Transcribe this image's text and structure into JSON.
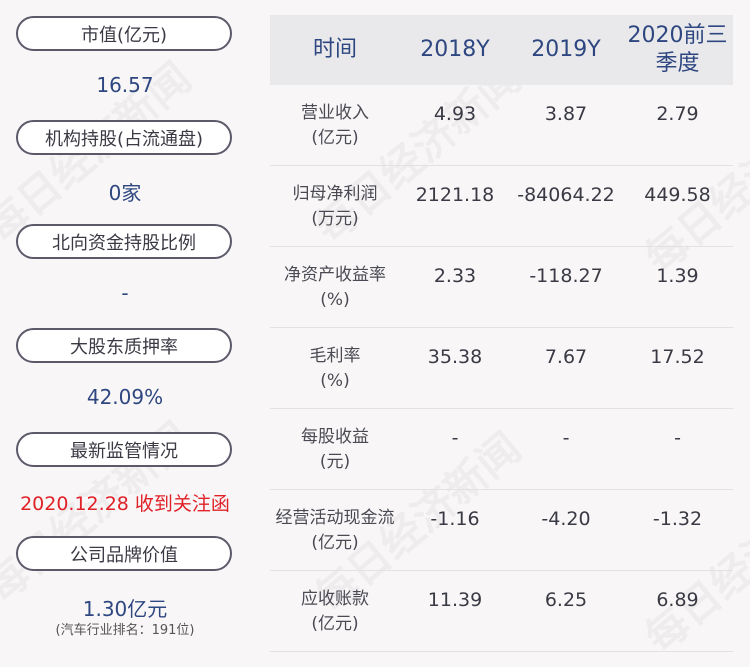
{
  "watermark_text": "每日经济新闻",
  "left": {
    "items": [
      {
        "label": "市值(亿元)",
        "value": "16.57"
      },
      {
        "label": "机构持股(占流通盘)",
        "value": "0家"
      },
      {
        "label": "北向资金持股比例",
        "value": "-"
      },
      {
        "label": "大股东质押率",
        "value": "42.09%"
      },
      {
        "label": "最新监管情况",
        "value": "2020.12.28 收到关注函"
      },
      {
        "label": "公司品牌价值",
        "value": "1.30亿元",
        "sub": "(汽车行业排名：191位)"
      }
    ]
  },
  "table": {
    "headers": [
      "时间",
      "2018Y",
      "2019Y",
      "2020前三季度"
    ],
    "rows": [
      {
        "label1": "营业收入",
        "label2": "(亿元)",
        "v": [
          "4.93",
          "3.87",
          "2.79"
        ]
      },
      {
        "label1": "归母净利润",
        "label2": "(万元)",
        "v": [
          "2121.18",
          "-84064.22",
          "449.58"
        ]
      },
      {
        "label1": "净资产收益率",
        "label2": "(%)",
        "v": [
          "2.33",
          "-118.27",
          "1.39"
        ]
      },
      {
        "label1": "毛利率",
        "label2": "(%)",
        "v": [
          "35.38",
          "7.67",
          "17.52"
        ]
      },
      {
        "label1": "每股收益",
        "label2": "(元)",
        "v": [
          "-",
          "-",
          "-"
        ]
      },
      {
        "label1": "经营活动现金流",
        "label2": "(亿元)",
        "v": [
          "-1.16",
          "-4.20",
          "-1.32"
        ]
      },
      {
        "label1": "应收账款",
        "label2": "(亿元)",
        "v": [
          "11.39",
          "6.25",
          "6.89"
        ]
      }
    ]
  },
  "colors": {
    "value_blue": "#2e4780",
    "alert_red": "#e02127",
    "pill_border": "#5c5a6a",
    "header_bg": "#e9e9ec"
  }
}
